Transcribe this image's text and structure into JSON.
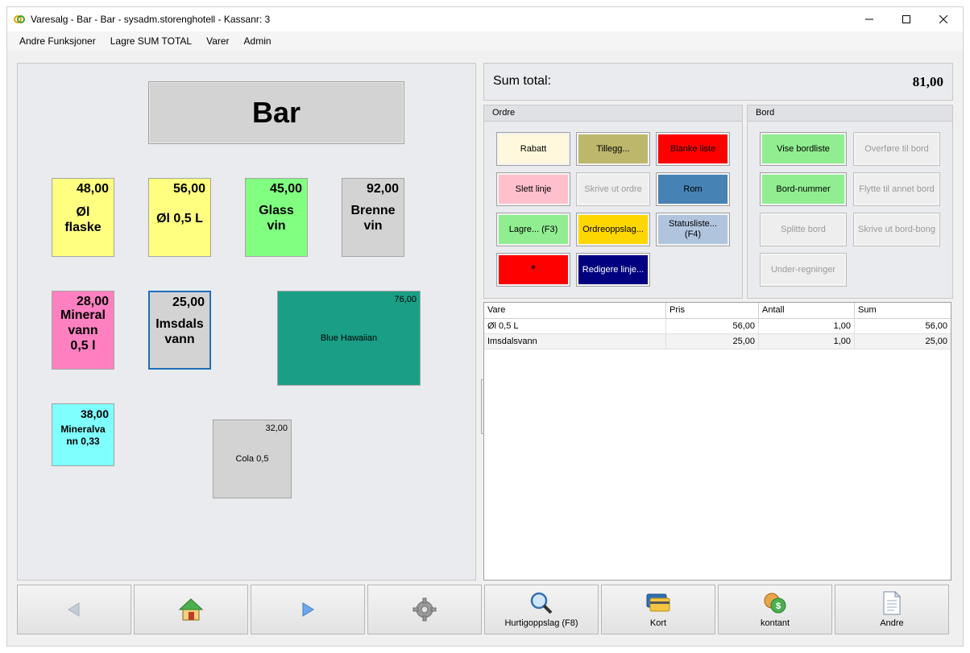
{
  "window": {
    "title": "Varesalg - Bar - Bar - sysadm.storenghotell -  Kassanr: 3"
  },
  "menu": [
    "Andre Funksjoner",
    "Lagre SUM TOTAL",
    "Varer",
    "Admin"
  ],
  "left": {
    "title": "Bar",
    "products": [
      {
        "price": "48,00",
        "name": "Øl flaske",
        "name_lines": [
          "Øl",
          "flaske"
        ],
        "color": "#ffff80"
      },
      {
        "price": "56,00",
        "name": "Øl 0,5 L",
        "name_lines": [
          "Øl 0,5 L"
        ],
        "color": "#ffff80"
      },
      {
        "price": "45,00",
        "name": "Glass vin",
        "name_lines": [
          "Glass",
          "vin"
        ],
        "color": "#80ff80"
      },
      {
        "price": "92,00",
        "name": "Brenne vin",
        "name_lines": [
          "Brenne",
          "vin"
        ],
        "color": "#d3d3d3"
      },
      {
        "price": "28,00",
        "name": "Mineral vann 0,5 l",
        "name_lines": [
          "Mineral",
          "vann",
          "0,5 l"
        ],
        "color": "#ff80c0"
      },
      {
        "price": "25,00",
        "name": "Imsdals vann",
        "name_lines": [
          "Imsdals",
          "vann"
        ],
        "color": "#d3d3d3"
      },
      {
        "price": "76,00",
        "name": "Blue Hawaiian",
        "color": "#1a9f86"
      },
      {
        "price": "38,00",
        "name": "Mineralvann 0,33",
        "name_lines": [
          "Mineralva",
          "nn 0,33"
        ],
        "color": "#80ffff"
      },
      {
        "price": "32,00",
        "name": "Cola 0,5",
        "color": "#d3d3d3"
      }
    ]
  },
  "sum": {
    "label": "Sum total:",
    "value": "81,00"
  },
  "ordre": {
    "header": "Ordre",
    "buttons": [
      {
        "label": "Rabatt",
        "color": "#fff8dc",
        "text_color": "#000000"
      },
      {
        "label": "Tillegg...",
        "color": "#bdb76b",
        "text_color": "#000000"
      },
      {
        "label": "Blanke liste",
        "color": "#ff0000",
        "text_color": "#000000"
      },
      {
        "label": "Slett linje",
        "color": "#ffc0cb",
        "text_color": "#000000"
      },
      {
        "label": "Skrive ut ordre",
        "disabled": true
      },
      {
        "label": "Rom",
        "color": "#4682b4",
        "text_color": "#000000"
      },
      {
        "label": "Lagre... (F3)",
        "color": "#90ee90",
        "text_color": "#000000"
      },
      {
        "label": "Ordreoppslag...",
        "color": "#ffd700",
        "text_color": "#000000"
      },
      {
        "label": "Statusliste... (F4)",
        "color": "#b0c4de",
        "text_color": "#000000"
      },
      {
        "label": "*",
        "color": "#ff0000",
        "text_color": "#000000"
      },
      {
        "label": "Redigere linje...",
        "color": "#000080",
        "text_color": "#ffffff"
      }
    ]
  },
  "bord": {
    "header": "Bord",
    "buttons": [
      {
        "label": "Vise bordliste",
        "color": "#90ee90",
        "text_color": "#000000"
      },
      {
        "label": "Overføre til bord",
        "disabled": true
      },
      {
        "label": "Bord-nummer",
        "color": "#90ee90",
        "text_color": "#000000"
      },
      {
        "label": "Flytte til annet bord",
        "disabled": true
      },
      {
        "label": "Splitte bord",
        "disabled": true
      },
      {
        "label": "Skrive ut bord-bong",
        "disabled": true
      },
      {
        "label": "Under-regninger",
        "disabled": true
      }
    ]
  },
  "grid": {
    "columns": [
      "Vare",
      "Pris",
      "Antall",
      "Sum"
    ],
    "rows": [
      [
        "Øl 0,5 L",
        "56,00",
        "1,00",
        "56,00"
      ],
      [
        "Imsdalsvann",
        "25,00",
        "1,00",
        "25,00"
      ]
    ]
  },
  "bottom": {
    "buttons": [
      {
        "icon": "arrow-left-icon",
        "label": ""
      },
      {
        "icon": "home-icon",
        "label": ""
      },
      {
        "icon": "arrow-right-icon",
        "label": ""
      },
      {
        "icon": "gear-icon",
        "label": ""
      },
      {
        "icon": "magnifier-icon",
        "label": "Hurtigoppslag (F8)"
      },
      {
        "icon": "cards-icon",
        "label": "Kort"
      },
      {
        "icon": "coins-icon",
        "label": "kontant"
      },
      {
        "icon": "document-icon",
        "label": "Andre"
      }
    ]
  }
}
